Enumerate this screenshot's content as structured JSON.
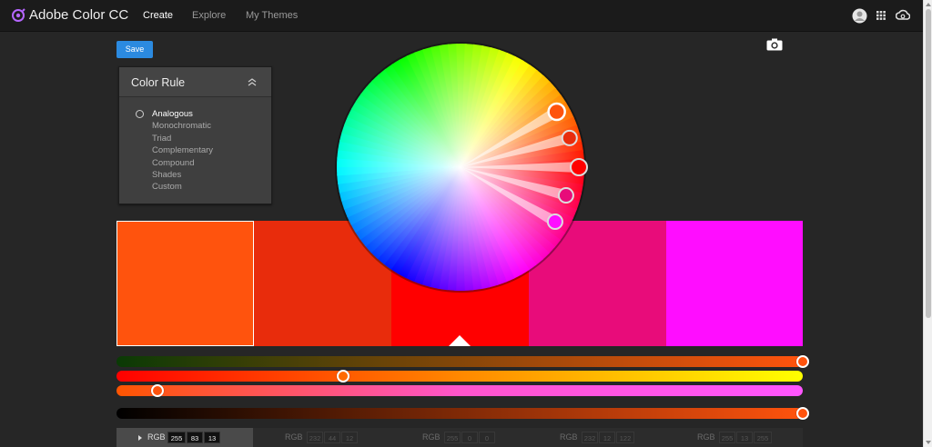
{
  "app": {
    "title": "Adobe Color CC"
  },
  "nav": {
    "items": [
      {
        "label": "Create",
        "active": true
      },
      {
        "label": "Explore",
        "active": false
      },
      {
        "label": "My Themes",
        "active": false
      }
    ]
  },
  "toolbar": {
    "save_label": "Save"
  },
  "color_rule": {
    "title": "Color Rule",
    "options": [
      "Analogous",
      "Monochromatic",
      "Triad",
      "Complementary",
      "Compound",
      "Shades",
      "Custom"
    ],
    "selected": "Analogous"
  },
  "swatches": [
    {
      "hex": "#FF530D",
      "selected": true
    },
    {
      "hex": "#E82C0C",
      "selected": false
    },
    {
      "hex": "#FF0000",
      "selected": false
    },
    {
      "hex": "#E80C7A",
      "selected": false
    },
    {
      "hex": "#FF0DFF",
      "selected": false
    }
  ],
  "sliders": [
    {
      "name": "brightness",
      "value": 1.0
    },
    {
      "name": "hue",
      "value": 0.33
    },
    {
      "name": "saturation",
      "value": 0.06
    },
    {
      "name": "value",
      "value": 1.0
    }
  ],
  "rgb": {
    "label": "RGB",
    "groups": [
      {
        "values": [
          "255",
          "83",
          "13"
        ],
        "active": true
      },
      {
        "values": [
          "232",
          "44",
          "12"
        ],
        "active": false
      },
      {
        "values": [
          "255",
          "0",
          "0"
        ],
        "active": false
      },
      {
        "values": [
          "232",
          "12",
          "122"
        ],
        "active": false
      },
      {
        "values": [
          "255",
          "13",
          "255"
        ],
        "active": false
      }
    ]
  },
  "icons": {
    "logo": "adobe-color-logo-icon",
    "user": "user-avatar-icon",
    "apps": "apps-grid-icon",
    "cloud": "creative-cloud-icon",
    "camera": "camera-icon",
    "collapse": "chevron-up-double-icon"
  }
}
